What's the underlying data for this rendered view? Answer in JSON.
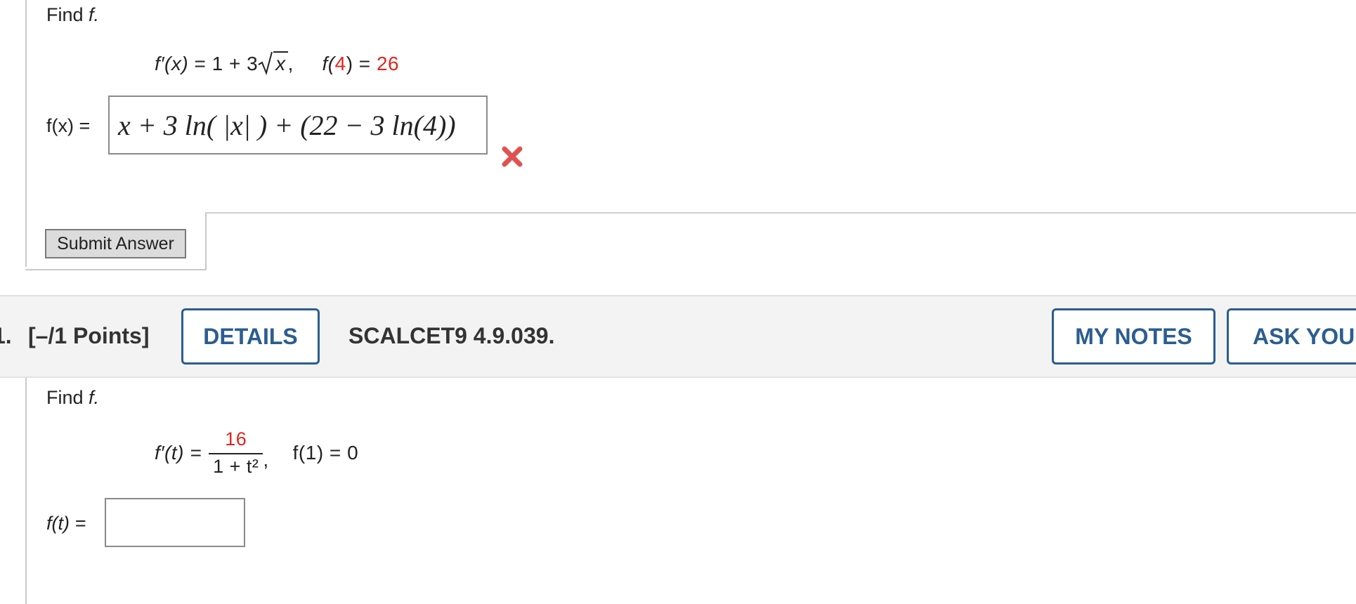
{
  "q1": {
    "prompt_find": "Find",
    "prompt_var": "f.",
    "given": {
      "fprime_lhs": "f′(x)",
      "fprime_rhs_prefix": "= 1 + 3",
      "sqrt_arg": "x",
      "sep": ",",
      "cond_f": "f(",
      "cond_arg": "4",
      "cond_close": ")",
      "cond_eq": "=",
      "cond_val": "26"
    },
    "answer_label": "f(x) =",
    "answer_value": "x + 3 ln( |x| ) + (22 − 3 ln(4))",
    "answer_status_icon": "incorrect-x-icon",
    "submit_label": "Submit Answer"
  },
  "header": {
    "number": "1.",
    "points": "[–/1 Points]",
    "details_label": "DETAILS",
    "code": "SCALCET9 4.9.039.",
    "my_notes_label": "MY NOTES",
    "ask_label": "ASK YOUR"
  },
  "q2": {
    "prompt_find": "Find",
    "prompt_var": "f.",
    "given": {
      "fprime_lhs": "f′(t) =",
      "numerator": "16",
      "denominator": "1 + t²",
      "sep": ",",
      "cond": "f(1) = 0"
    },
    "answer_label": "f(t) =",
    "answer_value": ""
  },
  "colors": {
    "accent_blue": "#2b5d90",
    "red_value": "#e0261e",
    "band_bg": "#f3f3f3"
  }
}
